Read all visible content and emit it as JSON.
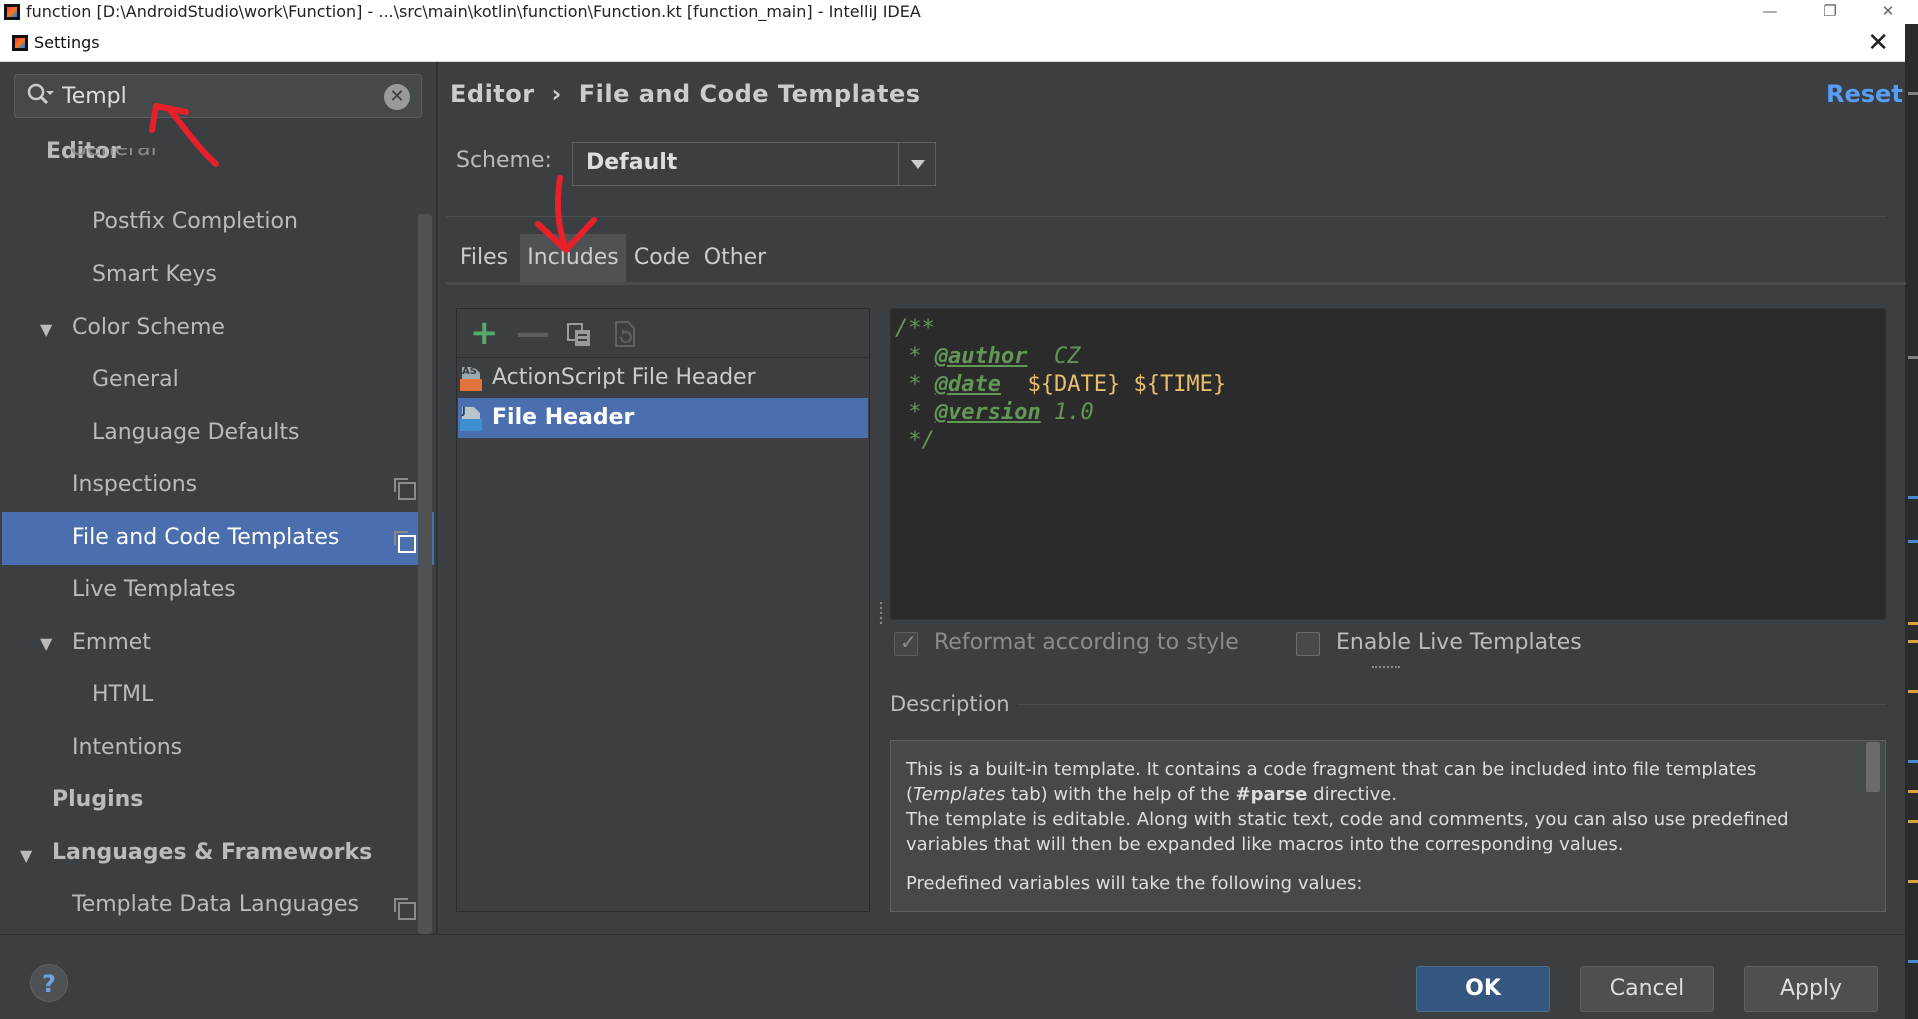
{
  "window": {
    "ide_title": "function [D:\\AndroidStudio\\work\\Function] - ...\\src\\main\\kotlin\\function\\Function.kt [function_main] - IntelliJ IDEA",
    "dialog_title": "Settings",
    "close_glyph": "✕",
    "minimize_glyph": "—",
    "restore_glyph": "❐"
  },
  "search": {
    "value": "Templ",
    "clear_glyph": "✕"
  },
  "tree": {
    "editor": "Editor",
    "general_partial": "General",
    "postfix": "Postfix Completion",
    "smart_keys": "Smart Keys",
    "color_scheme": "Color Scheme",
    "cs_general": "General",
    "language_defaults": "Language Defaults",
    "inspections": "Inspections",
    "file_code_templates": "File and Code Templates",
    "live_templates": "Live Templates",
    "emmet": "Emmet",
    "html": "HTML",
    "intentions": "Intentions",
    "plugins": "Plugins",
    "languages_frameworks": "Languages & Frameworks",
    "template_data_languages": "Template Data Languages",
    "expanded_arrow": "▼"
  },
  "header": {
    "breadcrumb_1": "Editor",
    "breadcrumb_sep": "›",
    "breadcrumb_2": "File and Code Templates",
    "reset": "Reset"
  },
  "scheme": {
    "label": "Scheme:",
    "value": "Default"
  },
  "tabs": {
    "files": "Files",
    "includes": "Includes",
    "code": "Code",
    "other": "Other"
  },
  "toolbar": {
    "add_glyph": "+",
    "remove_glyph": "—"
  },
  "templates": {
    "actionscript": "ActionScript File Header",
    "file_header": "File Header",
    "as_badge": "AS",
    "j_badge": "J"
  },
  "code": {
    "l1": "/**",
    "l2_prefix": " * ",
    "l2_tag": "@author",
    "l2_val": "  CZ",
    "l3_prefix": " * ",
    "l3_tag": "@date",
    "l3_sp": "  ",
    "l3_var1": "${DATE}",
    "l3_sp2": " ",
    "l3_var2": "${TIME}",
    "l4_prefix": " * ",
    "l4_tag": "@version",
    "l4_val": " 1.0",
    "l5": " */"
  },
  "options": {
    "reformat_label": "Reformat according to style",
    "live_templates_label": "Enable Live Templates",
    "checkmark": "✓"
  },
  "description": {
    "title": "Description",
    "p1_a": "This is a built-in template. It contains a code fragment that can be included into file templates (",
    "p1_i": "Templates",
    "p1_b": " tab) with the help of the ",
    "p1_bold": "#parse",
    "p1_c": " directive.",
    "p2": "The template is editable. Along with static text, code and comments, you can also use predefined variables that will then be expanded like macros into the corresponding values.",
    "p3": "Predefined variables will take the following values:"
  },
  "buttons": {
    "help": "?",
    "ok": "OK",
    "cancel": "Cancel",
    "apply": "Apply"
  },
  "colors": {
    "panel_bg": "#3c3f41",
    "editor_bg": "#2b2b2b",
    "selection": "#4b6eaf",
    "accent_link": "#589df6",
    "comment_green": "#629755",
    "template_var": "#e8bf6a",
    "annotation_red": "#e8202a"
  }
}
